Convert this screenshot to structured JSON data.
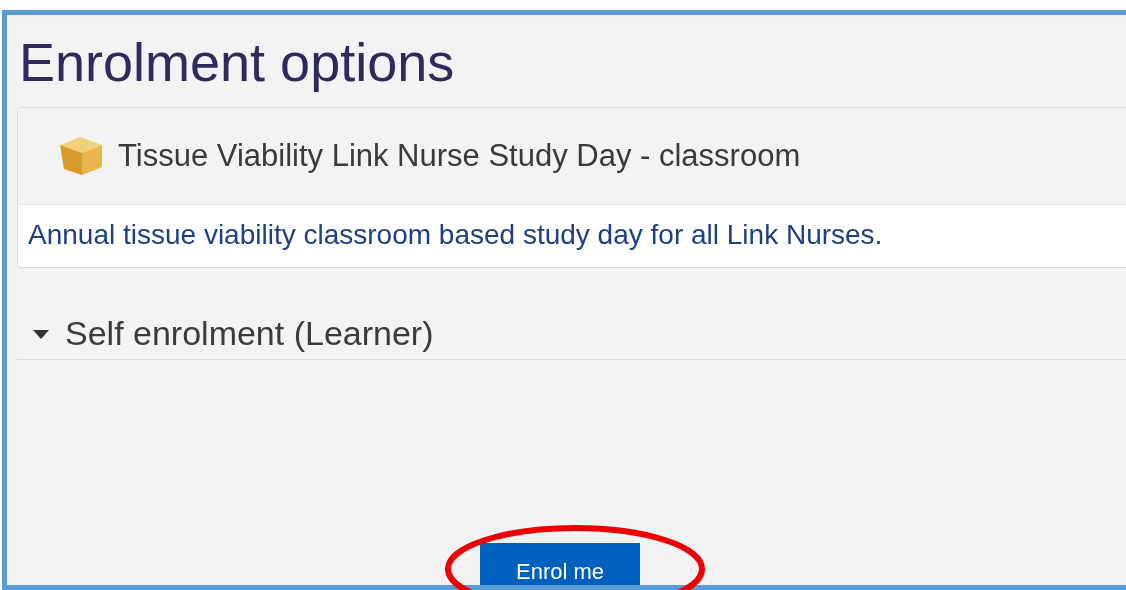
{
  "page_title": "Enrolment options",
  "course": {
    "name": "Tissue Viability Link Nurse Study Day - classroom",
    "summary": "Annual tissue viability classroom based study day for all Link Nurses."
  },
  "section": {
    "title": "Self enrolment (Learner)",
    "expanded": true
  },
  "button": {
    "label": "Enrol me",
    "highlighted": true
  }
}
